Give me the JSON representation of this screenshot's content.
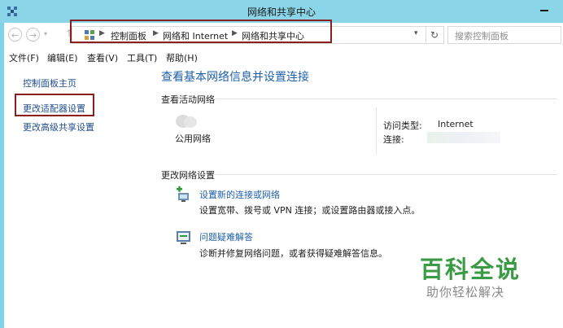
{
  "window": {
    "title": "网络和共享中心"
  },
  "address_bar": {
    "breadcrumbs": [
      "控制面板",
      "网络和 Internet",
      "网络和共享中心"
    ],
    "search_placeholder": "搜索控制面板"
  },
  "menu": [
    "文件(F)",
    "编辑(E)",
    "查看(V)",
    "工具(T)",
    "帮助(H)"
  ],
  "left_pane": {
    "home_link": "控制面板主页",
    "adapter_link": "更改适配器设置",
    "advanced_link": "更改高级共享设置"
  },
  "main": {
    "title": "查看基本网络信息并设置连接",
    "active_section": "查看活动网络",
    "network_name": "公用网络",
    "access_type_label": "访问类型:",
    "access_type_value": "Internet",
    "connection_label": "连接:",
    "change_section": "更改网络设置",
    "tasks": [
      {
        "link": "设置新的连接或网络",
        "desc": "设置宽带、拨号或 VPN 连接；或设置路由器或接入点。"
      },
      {
        "link": "问题疑难解答",
        "desc": "诊断并修复网络问题，或者获得疑难解答信息。"
      }
    ]
  },
  "watermark": {
    "main": "百科全说",
    "sub": "助你轻松解决"
  },
  "colors": {
    "titlebar": "#8ad6e8",
    "link": "#1e5fa8",
    "highlight": "#8a1f1f",
    "watermark": "#3a9b44"
  }
}
